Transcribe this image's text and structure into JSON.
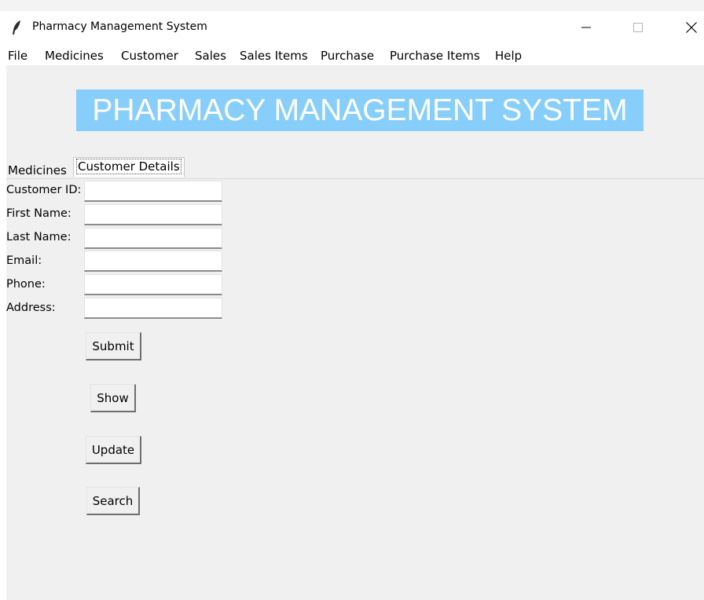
{
  "window": {
    "title": "Pharmacy Management System",
    "controls": {
      "minimize": "—",
      "maximize": "☐",
      "close": "✕"
    }
  },
  "menu": [
    "File",
    "Medicines",
    "Customer",
    "Sales",
    "Sales Items",
    "Purchase",
    "Purchase Items",
    "Help"
  ],
  "banner": {
    "text": "PHARMACY MANAGEMENT SYSTEM",
    "bg_color": "#87cefa",
    "text_color": "#ffffff"
  },
  "tabs": [
    {
      "label": "Medicines",
      "selected": false
    },
    {
      "label": "Customer Details",
      "selected": true
    }
  ],
  "form": {
    "fields": [
      {
        "label": "Customer ID:",
        "value": ""
      },
      {
        "label": "First Name:",
        "value": ""
      },
      {
        "label": "Last Name:",
        "value": ""
      },
      {
        "label": "Email:",
        "value": ""
      },
      {
        "label": "Phone:",
        "value": ""
      },
      {
        "label": "Address:",
        "value": ""
      }
    ]
  },
  "buttons": {
    "submit": "Submit",
    "show": "Show",
    "update": "Update",
    "search": "Search"
  }
}
